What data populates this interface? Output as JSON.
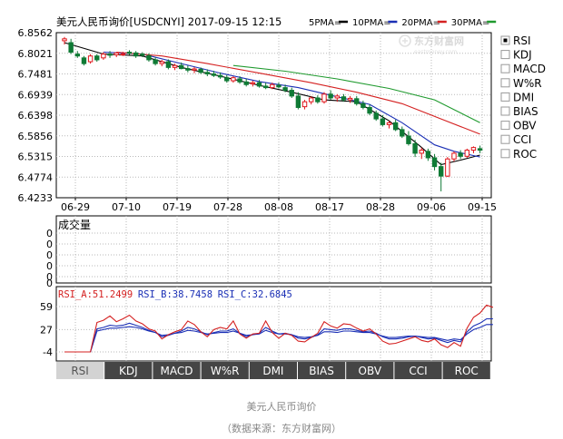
{
  "header": {
    "title": "美元人民币询价[USDCNYI] 2017-09-15 12:15",
    "ma_legend": [
      {
        "label": "5PMA=",
        "color": "#000000"
      },
      {
        "label": "10PMA=",
        "color": "#1a2fb5"
      },
      {
        "label": "20PMA=",
        "color": "#d42020"
      },
      {
        "label": "30PMA=",
        "color": "#1f9a2e"
      }
    ]
  },
  "watermark": {
    "name": "东方财富网",
    "url": "eastmoney.com"
  },
  "indicators": [
    {
      "label": "RSI",
      "checked": true
    },
    {
      "label": "KDJ",
      "checked": false
    },
    {
      "label": "MACD",
      "checked": false
    },
    {
      "label": "W%R",
      "checked": false
    },
    {
      "label": "DMI",
      "checked": false
    },
    {
      "label": "BIAS",
      "checked": false
    },
    {
      "label": "OBV",
      "checked": false
    },
    {
      "label": "CCI",
      "checked": false
    },
    {
      "label": "ROC",
      "checked": false
    }
  ],
  "volume_panel": {
    "title": "成交量",
    "ticks": [
      "0",
      "0",
      "0",
      "0",
      "0",
      "0"
    ]
  },
  "rsi_panel": {
    "labels": [
      {
        "text": "RSI_A:51.2499",
        "color": "#d42020"
      },
      {
        "text": "RSI_B:38.7458",
        "color": "#1a2fb5"
      },
      {
        "text": "RSI_C:32.6845",
        "color": "#1a2fb5"
      }
    ],
    "ticks": [
      "59",
      "27",
      "-4"
    ]
  },
  "tabs": [
    "RSI",
    "KDJ",
    "MACD",
    "W%R",
    "DMI",
    "BIAS",
    "OBV",
    "CCI",
    "ROC"
  ],
  "active_tab": "RSI",
  "caption": {
    "title": "美元人民币询价",
    "source": "（数据来源：东方财富网）"
  },
  "chart_data": {
    "type": "candlestick",
    "title": "美元人民币询价[USDCNYI] 2017-09-15 12:15",
    "y_ticks": [
      "6.8562",
      "6.8021",
      "6.7481",
      "6.6939",
      "6.6398",
      "6.5856",
      "6.5315",
      "6.4774",
      "6.4233"
    ],
    "ylim": [
      6.4233,
      6.8562
    ],
    "x_ticks": [
      "06-29",
      "07-10",
      "07-19",
      "07-28",
      "08-08",
      "08-17",
      "08-28",
      "09-06",
      "09-15"
    ],
    "candles": [
      {
        "o": 6.835,
        "h": 6.845,
        "l": 6.825,
        "c": 6.84
      },
      {
        "o": 6.83,
        "h": 6.84,
        "l": 6.8,
        "c": 6.805
      },
      {
        "o": 6.8,
        "h": 6.808,
        "l": 6.79,
        "c": 6.795
      },
      {
        "o": 6.79,
        "h": 6.795,
        "l": 6.77,
        "c": 6.775
      },
      {
        "o": 6.78,
        "h": 6.8,
        "l": 6.775,
        "c": 6.795
      },
      {
        "o": 6.795,
        "h": 6.8,
        "l": 6.78,
        "c": 6.785
      },
      {
        "o": 6.79,
        "h": 6.805,
        "l": 6.785,
        "c": 6.8
      },
      {
        "o": 6.8,
        "h": 6.808,
        "l": 6.79,
        "c": 6.797
      },
      {
        "o": 6.798,
        "h": 6.805,
        "l": 6.792,
        "c": 6.803
      },
      {
        "o": 6.8,
        "h": 6.806,
        "l": 6.795,
        "c": 6.8
      },
      {
        "o": 6.805,
        "h": 6.81,
        "l": 6.798,
        "c": 6.802
      },
      {
        "o": 6.803,
        "h": 6.808,
        "l": 6.79,
        "c": 6.795
      },
      {
        "o": 6.8,
        "h": 6.805,
        "l": 6.792,
        "c": 6.797
      },
      {
        "o": 6.796,
        "h": 6.802,
        "l": 6.78,
        "c": 6.785
      },
      {
        "o": 6.785,
        "h": 6.792,
        "l": 6.77,
        "c": 6.775
      },
      {
        "o": 6.775,
        "h": 6.785,
        "l": 6.768,
        "c": 6.78
      },
      {
        "o": 6.78,
        "h": 6.786,
        "l": 6.76,
        "c": 6.765
      },
      {
        "o": 6.765,
        "h": 6.775,
        "l": 6.758,
        "c": 6.77
      },
      {
        "o": 6.77,
        "h": 6.778,
        "l": 6.76,
        "c": 6.762
      },
      {
        "o": 6.762,
        "h": 6.77,
        "l": 6.752,
        "c": 6.758
      },
      {
        "o": 6.758,
        "h": 6.766,
        "l": 6.75,
        "c": 6.761
      },
      {
        "o": 6.76,
        "h": 6.765,
        "l": 6.748,
        "c": 6.752
      },
      {
        "o": 6.752,
        "h": 6.76,
        "l": 6.742,
        "c": 6.748
      },
      {
        "o": 6.748,
        "h": 6.756,
        "l": 6.74,
        "c": 6.744
      },
      {
        "o": 6.744,
        "h": 6.752,
        "l": 6.735,
        "c": 6.74
      },
      {
        "o": 6.738,
        "h": 6.745,
        "l": 6.725,
        "c": 6.73
      },
      {
        "o": 6.73,
        "h": 6.742,
        "l": 6.725,
        "c": 6.738
      },
      {
        "o": 6.735,
        "h": 6.742,
        "l": 6.722,
        "c": 6.727
      },
      {
        "o": 6.727,
        "h": 6.735,
        "l": 6.715,
        "c": 6.72
      },
      {
        "o": 6.722,
        "h": 6.73,
        "l": 6.715,
        "c": 6.725
      },
      {
        "o": 6.725,
        "h": 6.732,
        "l": 6.712,
        "c": 6.716
      },
      {
        "o": 6.716,
        "h": 6.725,
        "l": 6.708,
        "c": 6.712
      },
      {
        "o": 6.712,
        "h": 6.725,
        "l": 6.708,
        "c": 6.72
      },
      {
        "o": 6.718,
        "h": 6.725,
        "l": 6.71,
        "c": 6.714
      },
      {
        "o": 6.712,
        "h": 6.72,
        "l": 6.7,
        "c": 6.705
      },
      {
        "o": 6.705,
        "h": 6.712,
        "l": 6.685,
        "c": 6.69
      },
      {
        "o": 6.69,
        "h": 6.7,
        "l": 6.655,
        "c": 6.66
      },
      {
        "o": 6.662,
        "h": 6.68,
        "l": 6.655,
        "c": 6.675
      },
      {
        "o": 6.675,
        "h": 6.69,
        "l": 6.668,
        "c": 6.685
      },
      {
        "o": 6.685,
        "h": 6.692,
        "l": 6.67,
        "c": 6.675
      },
      {
        "o": 6.675,
        "h": 6.7,
        "l": 6.67,
        "c": 6.695
      },
      {
        "o": 6.695,
        "h": 6.705,
        "l": 6.68,
        "c": 6.685
      },
      {
        "o": 6.685,
        "h": 6.695,
        "l": 6.675,
        "c": 6.69
      },
      {
        "o": 6.688,
        "h": 6.695,
        "l": 6.675,
        "c": 6.68
      },
      {
        "o": 6.68,
        "h": 6.69,
        "l": 6.672,
        "c": 6.684
      },
      {
        "o": 6.683,
        "h": 6.69,
        "l": 6.665,
        "c": 6.67
      },
      {
        "o": 6.67,
        "h": 6.678,
        "l": 6.655,
        "c": 6.66
      },
      {
        "o": 6.66,
        "h": 6.668,
        "l": 6.64,
        "c": 6.645
      },
      {
        "o": 6.645,
        "h": 6.652,
        "l": 6.625,
        "c": 6.63
      },
      {
        "o": 6.63,
        "h": 6.64,
        "l": 6.61,
        "c": 6.615
      },
      {
        "o": 6.615,
        "h": 6.625,
        "l": 6.605,
        "c": 6.62
      },
      {
        "o": 6.62,
        "h": 6.628,
        "l": 6.598,
        "c": 6.602
      },
      {
        "o": 6.602,
        "h": 6.61,
        "l": 6.58,
        "c": 6.585
      },
      {
        "o": 6.585,
        "h": 6.598,
        "l": 6.56,
        "c": 6.565
      },
      {
        "o": 6.565,
        "h": 6.575,
        "l": 6.53,
        "c": 6.54
      },
      {
        "o": 6.54,
        "h": 6.555,
        "l": 6.525,
        "c": 6.548
      },
      {
        "o": 6.545,
        "h": 6.552,
        "l": 6.52,
        "c": 6.528
      },
      {
        "o": 6.528,
        "h": 6.538,
        "l": 6.495,
        "c": 6.505
      },
      {
        "o": 6.505,
        "h": 6.515,
        "l": 6.44,
        "c": 6.48
      },
      {
        "o": 6.48,
        "h": 6.53,
        "l": 6.478,
        "c": 6.525
      },
      {
        "o": 6.525,
        "h": 6.545,
        "l": 6.518,
        "c": 6.54
      },
      {
        "o": 6.54,
        "h": 6.548,
        "l": 6.525,
        "c": 6.532
      },
      {
        "o": 6.532,
        "h": 6.552,
        "l": 6.528,
        "c": 6.548
      },
      {
        "o": 6.548,
        "h": 6.558,
        "l": 6.54,
        "c": 6.555
      },
      {
        "o": 6.552,
        "h": 6.56,
        "l": 6.54,
        "c": 6.548
      }
    ],
    "ma": {
      "ma5": [
        [
          0,
          6.83
        ],
        [
          6,
          6.8
        ],
        [
          12,
          6.795
        ],
        [
          18,
          6.765
        ],
        [
          24,
          6.742
        ],
        [
          30,
          6.718
        ],
        [
          35,
          6.7
        ],
        [
          40,
          6.68
        ],
        [
          45,
          6.675
        ],
        [
          50,
          6.625
        ],
        [
          55,
          6.555
        ],
        [
          58,
          6.51
        ],
        [
          61,
          6.522
        ],
        [
          64,
          6.535
        ]
      ],
      "ma10": [
        [
          6,
          6.805
        ],
        [
          12,
          6.8
        ],
        [
          18,
          6.775
        ],
        [
          24,
          6.75
        ],
        [
          30,
          6.728
        ],
        [
          36,
          6.712
        ],
        [
          42,
          6.688
        ],
        [
          47,
          6.668
        ],
        [
          52,
          6.62
        ],
        [
          57,
          6.562
        ],
        [
          60,
          6.545
        ],
        [
          64,
          6.53
        ]
      ],
      "ma20": [
        [
          8,
          6.805
        ],
        [
          15,
          6.795
        ],
        [
          22,
          6.775
        ],
        [
          30,
          6.75
        ],
        [
          38,
          6.725
        ],
        [
          45,
          6.7
        ],
        [
          52,
          6.67
        ],
        [
          58,
          6.63
        ],
        [
          64,
          6.59
        ]
      ],
      "ma30": [
        [
          26,
          6.77
        ],
        [
          34,
          6.755
        ],
        [
          42,
          6.735
        ],
        [
          50,
          6.71
        ],
        [
          57,
          6.68
        ],
        [
          64,
          6.62
        ]
      ]
    },
    "rsi": {
      "ylim": [
        -4,
        59
      ],
      "rsi_a": [
        -4,
        -4,
        -4,
        -4,
        -4,
        37,
        40,
        46,
        38,
        42,
        47,
        39,
        35,
        28,
        25,
        14,
        20,
        24,
        27,
        39,
        34,
        24,
        17,
        27,
        30,
        28,
        39,
        21,
        15,
        21,
        22,
        39,
        23,
        15,
        22,
        19,
        11,
        10,
        16,
        22,
        38,
        32,
        29,
        35,
        34,
        29,
        25,
        28,
        21,
        11,
        7,
        8,
        11,
        14,
        17,
        12,
        10,
        14,
        6,
        2,
        9,
        4,
        29,
        44,
        50,
        61,
        58
      ],
      "rsi_b": [
        -4,
        -4,
        -4,
        -4,
        -4,
        28,
        30,
        33,
        32,
        33,
        36,
        33,
        30,
        26,
        23,
        17,
        19,
        22,
        25,
        30,
        28,
        24,
        20,
        23,
        25,
        25,
        28,
        22,
        17,
        20,
        22,
        30,
        25,
        21,
        22,
        20,
        15,
        14,
        16,
        20,
        28,
        27,
        26,
        28,
        28,
        26,
        24,
        25,
        22,
        17,
        14,
        14,
        15,
        17,
        18,
        16,
        14,
        15,
        12,
        9,
        12,
        10,
        24,
        32,
        36,
        42,
        42
      ],
      "rsi_c": [
        -4,
        -4,
        -4,
        -4,
        -4,
        25,
        27,
        29,
        29,
        30,
        31,
        30,
        28,
        25,
        23,
        19,
        20,
        22,
        23,
        26,
        25,
        23,
        21,
        22,
        23,
        23,
        25,
        22,
        19,
        20,
        21,
        26,
        23,
        21,
        21,
        20,
        17,
        16,
        17,
        19,
        24,
        24,
        23,
        25,
        25,
        24,
        23,
        23,
        21,
        18,
        16,
        16,
        17,
        18,
        18,
        17,
        16,
        16,
        14,
        12,
        14,
        13,
        21,
        27,
        30,
        34,
        34
      ]
    }
  }
}
